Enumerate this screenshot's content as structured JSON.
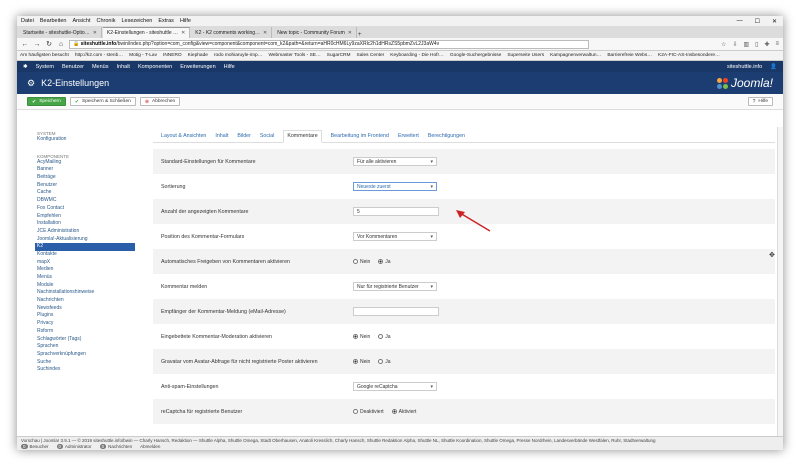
{
  "browser": {
    "menu": [
      "Datei",
      "Bearbeiten",
      "Ansicht",
      "Chronik",
      "Lesezeichen",
      "Extras",
      "Hilfe"
    ],
    "tabs": [
      {
        "label": "Startseite - siteshuttle-Optio…",
        "active": false
      },
      {
        "label": "K2-Einstellungen - siteshuttle …",
        "active": true
      },
      {
        "label": "K2 - K2 comments working…",
        "active": false
      },
      {
        "label": "New topic - Community Forum",
        "active": false
      }
    ],
    "url_host": "siteshuttle.info",
    "url_rest": "/bwin/index.php?option=com_config&view=component&component=com_k2&path=&return=aHR0cHM6Ly9zaXRlc2h1dHRsZS5pbmZvL2J3aW4v",
    "bookmarks": [
      "Am häufigsten besucht",
      "http://k2.com - stenb…",
      "Motig - T-Lav",
      "INNERO",
      "Kiephade",
      "rodo mohiaruyle-imp…",
      "Webmaster Tools - SE…",
      "SugarCRM",
      "Sales Center",
      "Keyboarding - Die Hofr…",
      "Google-Suchergebnisse",
      "Superseite Users",
      "Kampagnenverwaltun…",
      "Barrierefreie Webs…",
      "K2A-FIC-AS-Insbesondere…"
    ]
  },
  "joomla": {
    "topnav": [
      "System",
      "Benutzer",
      "Menüs",
      "Inhalt",
      "Komponenten",
      "Erweiterungen",
      "Hilfe"
    ],
    "site_link": "siteshuttle.info",
    "title": "K2-Einstellungen",
    "logo": "Joomla!",
    "toolbar": {
      "save": "Speichern",
      "save_close": "Speichern & Schließen",
      "cancel": "Abbrechen",
      "help": "Hilfe"
    }
  },
  "sidebar": {
    "section1": "SYSTEM",
    "item1": "Konfiguration",
    "section2": "KOMPONENTE",
    "items": [
      "AcyMailing",
      "Banner",
      "Beiträge",
      "Benutzer",
      "Cache",
      "DBWMC",
      "Fox Contact",
      "Empfehlen",
      "Installation",
      "JCE Administration",
      "Joomla!-Aktualisierung",
      "K2",
      "Kontakte",
      "mapX",
      "Medien",
      "Menüs",
      "Module",
      "Nachinstallationshinweise",
      "Nachrichten",
      "Newsfeeds",
      "Plugins",
      "Privacy",
      "Rsform",
      "Schlagwörter (Tags)",
      "Sprachen",
      "Sprachverknüpfungen",
      "Suche",
      "Suchindex"
    ],
    "active_index": 11
  },
  "tabs": [
    "Layout & Ansichten",
    "Inhalt",
    "Bilder",
    "Social",
    "Kommentare",
    "Bearbeitung im Frontend",
    "Erweitert",
    "Berechtigungen"
  ],
  "active_tab_index": 4,
  "form": [
    {
      "label": "Standard-Einstellungen für Kommentare",
      "type": "select",
      "value": "Für alle aktivieren"
    },
    {
      "label": "Sortierung",
      "type": "select",
      "value": "Neueste zuerst",
      "focused": true
    },
    {
      "label": "Anzahl der angezeigten Kommentare",
      "type": "text",
      "value": "5"
    },
    {
      "label": "Position des Kommentar-Formulars",
      "type": "select",
      "value": "Vor Kommentaren"
    },
    {
      "label": "Automatisches Freigeben von Kommentaren aktivieren",
      "type": "radio",
      "options": [
        "Nein",
        "Ja"
      ],
      "selected": 1
    },
    {
      "label": "Kommentar melden",
      "type": "select",
      "value": "Nur für registrierte Benutzer"
    },
    {
      "label": "Empfänger der Kommentar-Meldung (eMail-Adresse)",
      "type": "text",
      "value": ""
    },
    {
      "label": "Eingebettete Kommentar-Moderation aktivieren",
      "type": "radio",
      "options": [
        "Nein",
        "Ja"
      ],
      "selected": 0
    },
    {
      "label": "Gravatar vom Avatar-Abfrage für nicht registrierte Poster aktivieren",
      "type": "radio",
      "options": [
        "Nein",
        "Ja"
      ],
      "selected": 0
    },
    {
      "label": "Anti-spam-Einstellungen",
      "type": "select",
      "value": "Google reCaptcha"
    },
    {
      "label": "reCaptcha für registrierte Benutzer",
      "type": "radio",
      "options": [
        "Deaktiviert",
        "Aktiviert"
      ],
      "selected": 1
    }
  ],
  "footer": {
    "line1": "Vorschau | Joomla! 3.9.1 — © 2019 siteshuttle.info/bwin — Charly Hansch, Redaktion — Shuttle Alpha, Shuttle Omega, Stadt Oberhausen, Anatoli Kresslich, Charly Hansch, Shuttle Redaktion Alpha, Shuttle NL, Shuttle Koordination, Shuttle Omega, Presse Nordrhein, Landesverbände Westfalen, Ruhr, Stadtverwaltung",
    "items": [
      {
        "count": "0",
        "label": "Besucher"
      },
      {
        "count": "0",
        "label": "Administrator"
      },
      {
        "count": "0",
        "label": "Nachrichten"
      },
      {
        "count": "",
        "label": "Abmelden"
      }
    ]
  },
  "colors": {
    "header_bg": "#1c3d72",
    "topnav_bg": "#1a3867",
    "save_green": "#46a546",
    "active_sidebar": "#2a5ea8",
    "arrow": "#cc2222"
  }
}
